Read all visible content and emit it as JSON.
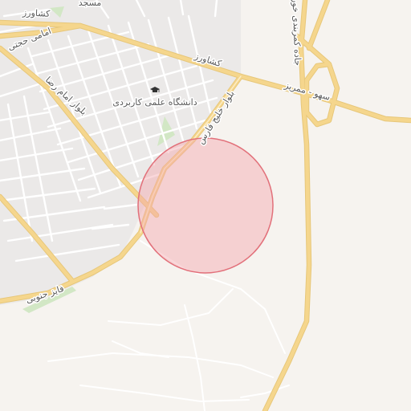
{
  "map": {
    "colors": {
      "background": "#f6f3ef",
      "urban": "#ebe9e8",
      "street": "#ffffff",
      "major_road": "#f5d68d",
      "major_road_casing": "#e7c77a",
      "park": "#d2e7c5",
      "highlight_fill": "#f5a7ae",
      "highlight_stroke": "#e2707a",
      "label": "#5a5a5a"
    },
    "labels": {
      "masjed": "مسجد",
      "keshavarz_top": "کشاورز",
      "keshavarz_mid": "کشاورز",
      "amami_hojati": "امامی حجتی",
      "blvd_emam_reza": "بلوار امام رضا",
      "university": "دانشگاه علمی کاربردی",
      "blvd_khalij_fars": "بلوار خلیج فارس",
      "sahv_mariz": "سهو - ممریز",
      "ring_road": "جاده کمربندی خور",
      "faiz_south": "فایز جنوبی"
    },
    "icons": {
      "university": "graduation-cap-icon"
    },
    "highlight_area": "selected-location-circle"
  }
}
